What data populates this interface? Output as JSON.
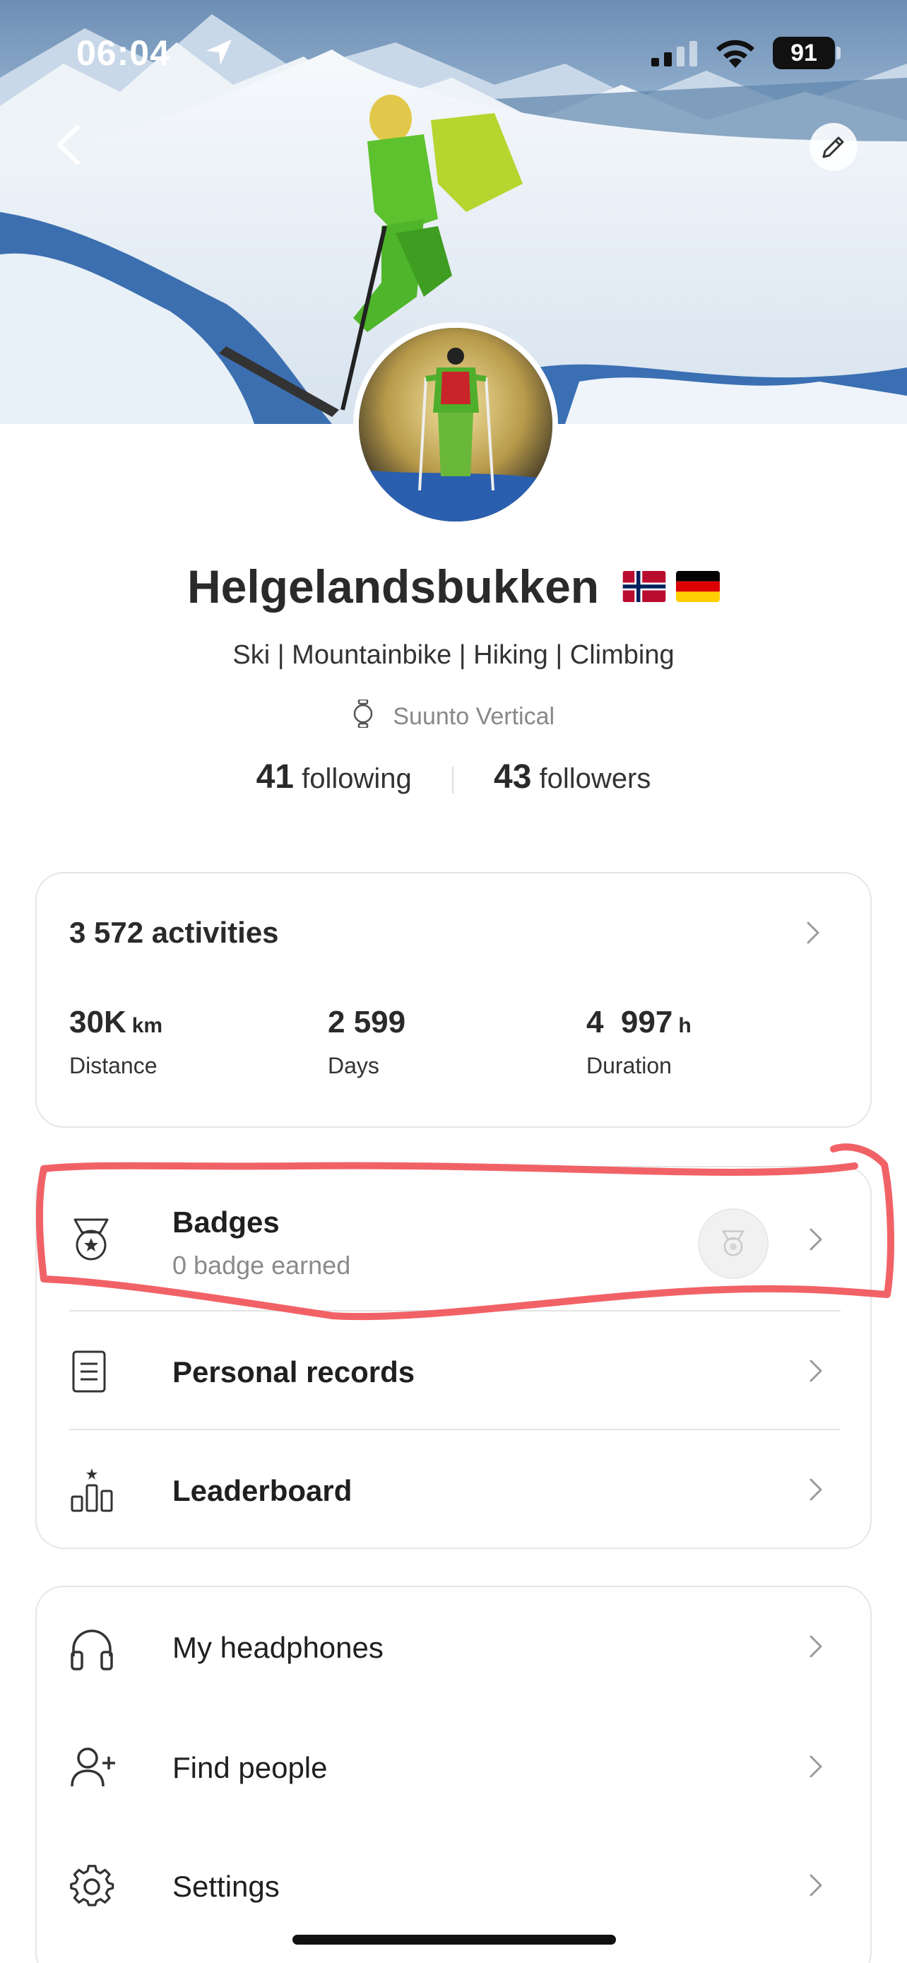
{
  "status_bar": {
    "time": "06:04",
    "battery": "91"
  },
  "profile": {
    "name": "Helgelandsbukken",
    "flags": [
      "norway-flag",
      "germany-flag"
    ],
    "sports": "Ski |  Mountainbike | Hiking | Climbing",
    "device": "Suunto Vertical",
    "following_count": "41",
    "following_label": "following",
    "followers_count": "43",
    "followers_label": "followers"
  },
  "activities": {
    "title": "3 572 activities",
    "stats": [
      {
        "value": "30K",
        "unit": "km",
        "label": "Distance"
      },
      {
        "value": "2 599",
        "unit": "",
        "label": "Days"
      },
      {
        "value": "4  997",
        "unit": "h",
        "label": "Duration"
      }
    ]
  },
  "achievements": {
    "badges_label": "Badges",
    "badges_sub": "0 badge earned",
    "records_label": "Personal records",
    "leaderboard_label": "Leaderboard"
  },
  "menu": {
    "headphones_label": "My headphones",
    "find_people_label": "Find people",
    "settings_label": "Settings"
  },
  "colors": {
    "highlight": "#f0555a",
    "text_dark": "#2a2a2a",
    "text_muted": "#8a8a8a",
    "card_border": "#e6e6e6"
  },
  "icons": {
    "back": "chevron-left-icon",
    "edit": "pencil-icon",
    "watch": "watch-icon",
    "badge": "medal-icon",
    "records": "document-icon",
    "leaderboard": "podium-icon",
    "headphones": "headphones-icon",
    "find_people": "add-person-icon",
    "settings": "gear-icon"
  }
}
